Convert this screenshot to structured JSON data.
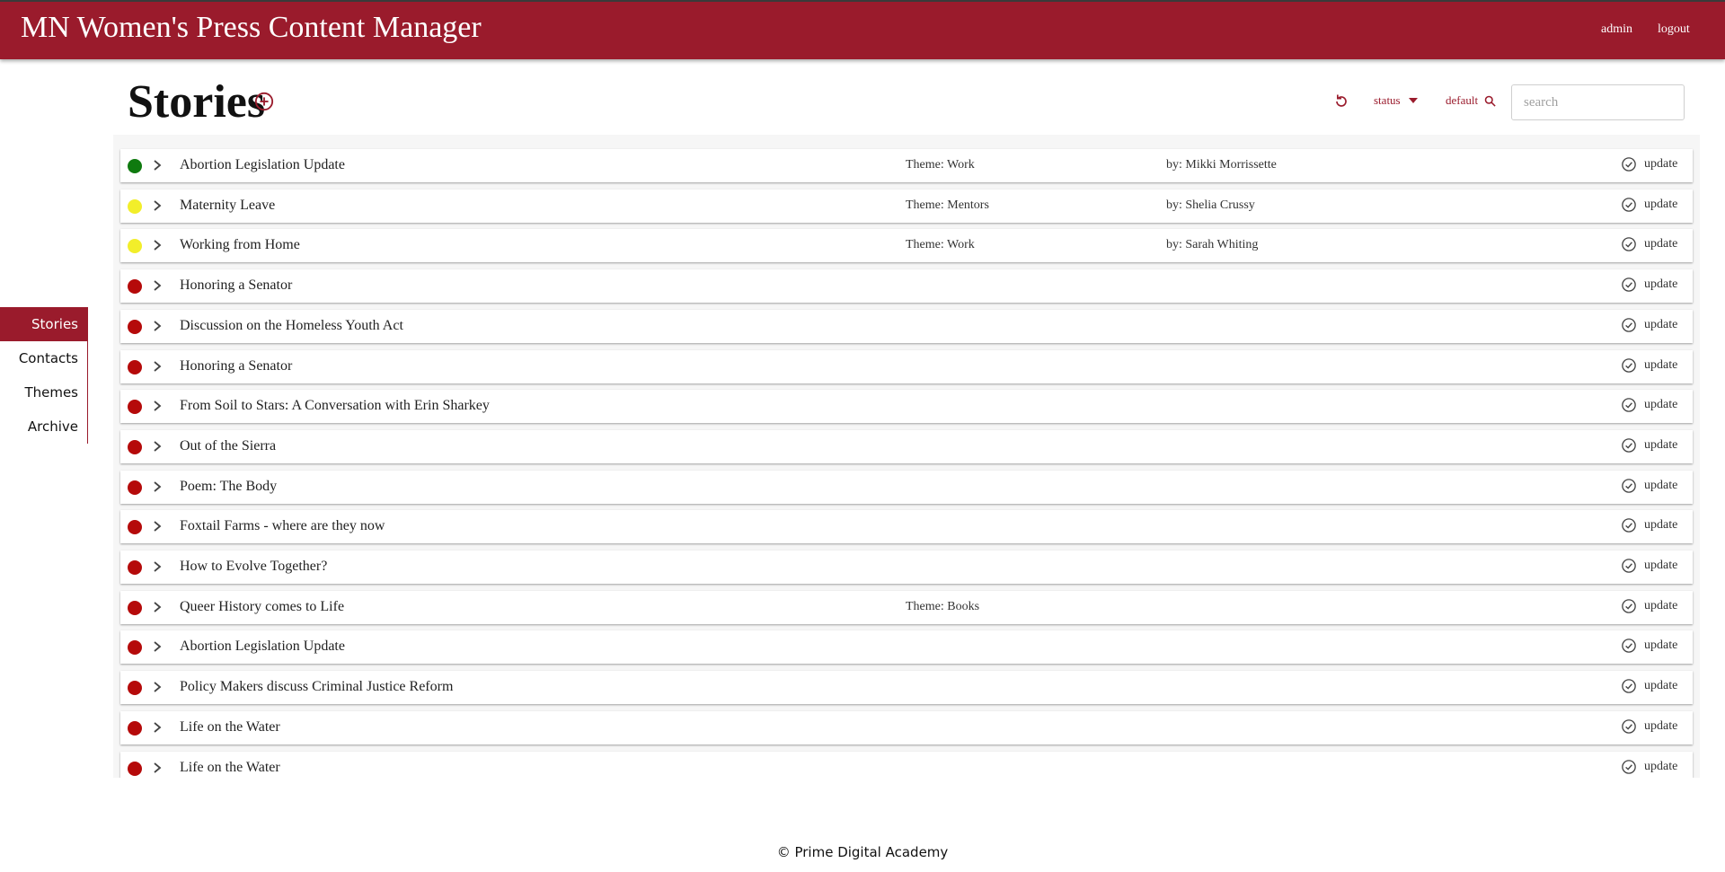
{
  "header": {
    "app_title": "MN Women's Press Content Manager",
    "admin_label": "admin",
    "logout_label": "logout"
  },
  "page": {
    "title": "Stories",
    "add_icon": "plus-circle-icon"
  },
  "toolbar": {
    "refresh_icon": "refresh-icon",
    "status_label": "status",
    "status_icon": "caret-down-icon",
    "sort_label": "default",
    "sort_icon": "search-icon",
    "search_placeholder": "search"
  },
  "sidebar": {
    "items": [
      {
        "label": "Stories",
        "active": true
      },
      {
        "label": "Contacts",
        "active": false
      },
      {
        "label": "Themes",
        "active": false
      },
      {
        "label": "Archive",
        "active": false
      }
    ]
  },
  "colors": {
    "brand": "#9a1b2c",
    "status_green": "#0f7a0f",
    "status_yellow": "#f2ee2a",
    "status_red": "#b50a0a"
  },
  "stories": [
    {
      "status": "green",
      "title": "Abortion Legislation Update",
      "theme": "Theme: Work",
      "author": "by: Mikki Morrissette",
      "action": "update"
    },
    {
      "status": "yellow",
      "title": "Maternity Leave",
      "theme": "Theme: Mentors",
      "author": "by: Shelia Crussy",
      "action": "update"
    },
    {
      "status": "yellow",
      "title": "Working from Home",
      "theme": "Theme: Work",
      "author": "by: Sarah Whiting",
      "action": "update"
    },
    {
      "status": "red",
      "title": "Honoring a Senator",
      "theme": "",
      "author": "",
      "action": "update"
    },
    {
      "status": "red",
      "title": "Discussion on the Homeless Youth Act",
      "theme": "",
      "author": "",
      "action": "update"
    },
    {
      "status": "red",
      "title": "Honoring a Senator",
      "theme": "",
      "author": "",
      "action": "update"
    },
    {
      "status": "red",
      "title": "From Soil to Stars: A Conversation with Erin Sharkey",
      "theme": "",
      "author": "",
      "action": "update"
    },
    {
      "status": "red",
      "title": "Out of the Sierra",
      "theme": "",
      "author": "",
      "action": "update"
    },
    {
      "status": "red",
      "title": "Poem: The Body",
      "theme": "",
      "author": "",
      "action": "update"
    },
    {
      "status": "red",
      "title": "Foxtail Farms - where are they now",
      "theme": "",
      "author": "",
      "action": "update"
    },
    {
      "status": "red",
      "title": "How to Evolve Together?",
      "theme": "",
      "author": "",
      "action": "update"
    },
    {
      "status": "red",
      "title": "Queer History comes to Life",
      "theme": "Theme: Books",
      "author": "",
      "action": "update"
    },
    {
      "status": "red",
      "title": "Abortion Legislation Update",
      "theme": "",
      "author": "",
      "action": "update"
    },
    {
      "status": "red",
      "title": "Policy Makers discuss Criminal Justice Reform",
      "theme": "",
      "author": "",
      "action": "update"
    },
    {
      "status": "red",
      "title": "Life on the Water",
      "theme": "",
      "author": "",
      "action": "update"
    },
    {
      "status": "red",
      "title": "Life on the Water",
      "theme": "",
      "author": "",
      "action": "update"
    }
  ],
  "footer": {
    "text": "© Prime Digital Academy"
  }
}
